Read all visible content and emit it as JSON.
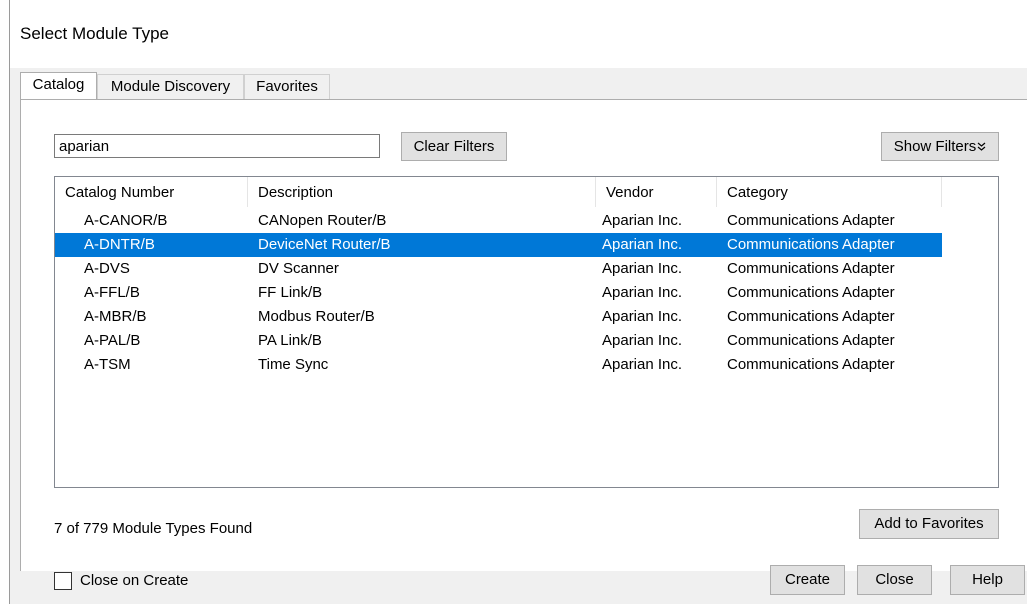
{
  "dialog": {
    "title": "Select Module Type"
  },
  "tabs": [
    {
      "label": "Catalog",
      "active": true
    },
    {
      "label": "Module Discovery",
      "active": false
    },
    {
      "label": "Favorites",
      "active": false
    }
  ],
  "search": {
    "value": "aparian"
  },
  "buttons": {
    "clear_filters": "Clear Filters",
    "show_filters": "Show Filters",
    "show_filters_icon": "double-chevron-down-icon",
    "add_to_favorites": "Add to Favorites",
    "create": "Create",
    "close": "Close",
    "help": "Help"
  },
  "table": {
    "columns": [
      "Catalog Number",
      "Description",
      "Vendor",
      "Category"
    ],
    "rows": [
      {
        "catalog": "A-CANOR/B",
        "description": "CANopen Router/B",
        "vendor": "Aparian Inc.",
        "category": "Communications Adapter",
        "selected": false
      },
      {
        "catalog": "A-DNTR/B",
        "description": "DeviceNet Router/B",
        "vendor": "Aparian Inc.",
        "category": "Communications Adapter",
        "selected": true
      },
      {
        "catalog": "A-DVS",
        "description": "DV Scanner",
        "vendor": "Aparian Inc.",
        "category": "Communications Adapter",
        "selected": false
      },
      {
        "catalog": "A-FFL/B",
        "description": "FF Link/B",
        "vendor": "Aparian Inc.",
        "category": "Communications Adapter",
        "selected": false
      },
      {
        "catalog": "A-MBR/B",
        "description": "Modbus Router/B",
        "vendor": "Aparian Inc.",
        "category": "Communications Adapter",
        "selected": false
      },
      {
        "catalog": "A-PAL/B",
        "description": "PA Link/B",
        "vendor": "Aparian Inc.",
        "category": "Communications Adapter",
        "selected": false
      },
      {
        "catalog": "A-TSM",
        "description": "Time Sync",
        "vendor": "Aparian Inc.",
        "category": "Communications Adapter",
        "selected": false
      }
    ]
  },
  "status": {
    "found_text": "7 of 779 Module Types Found"
  },
  "close_on_create": {
    "label": "Close on Create",
    "checked": false
  },
  "colors": {
    "selection": "#0078d7",
    "dialog_bg": "#f0f0f0"
  }
}
